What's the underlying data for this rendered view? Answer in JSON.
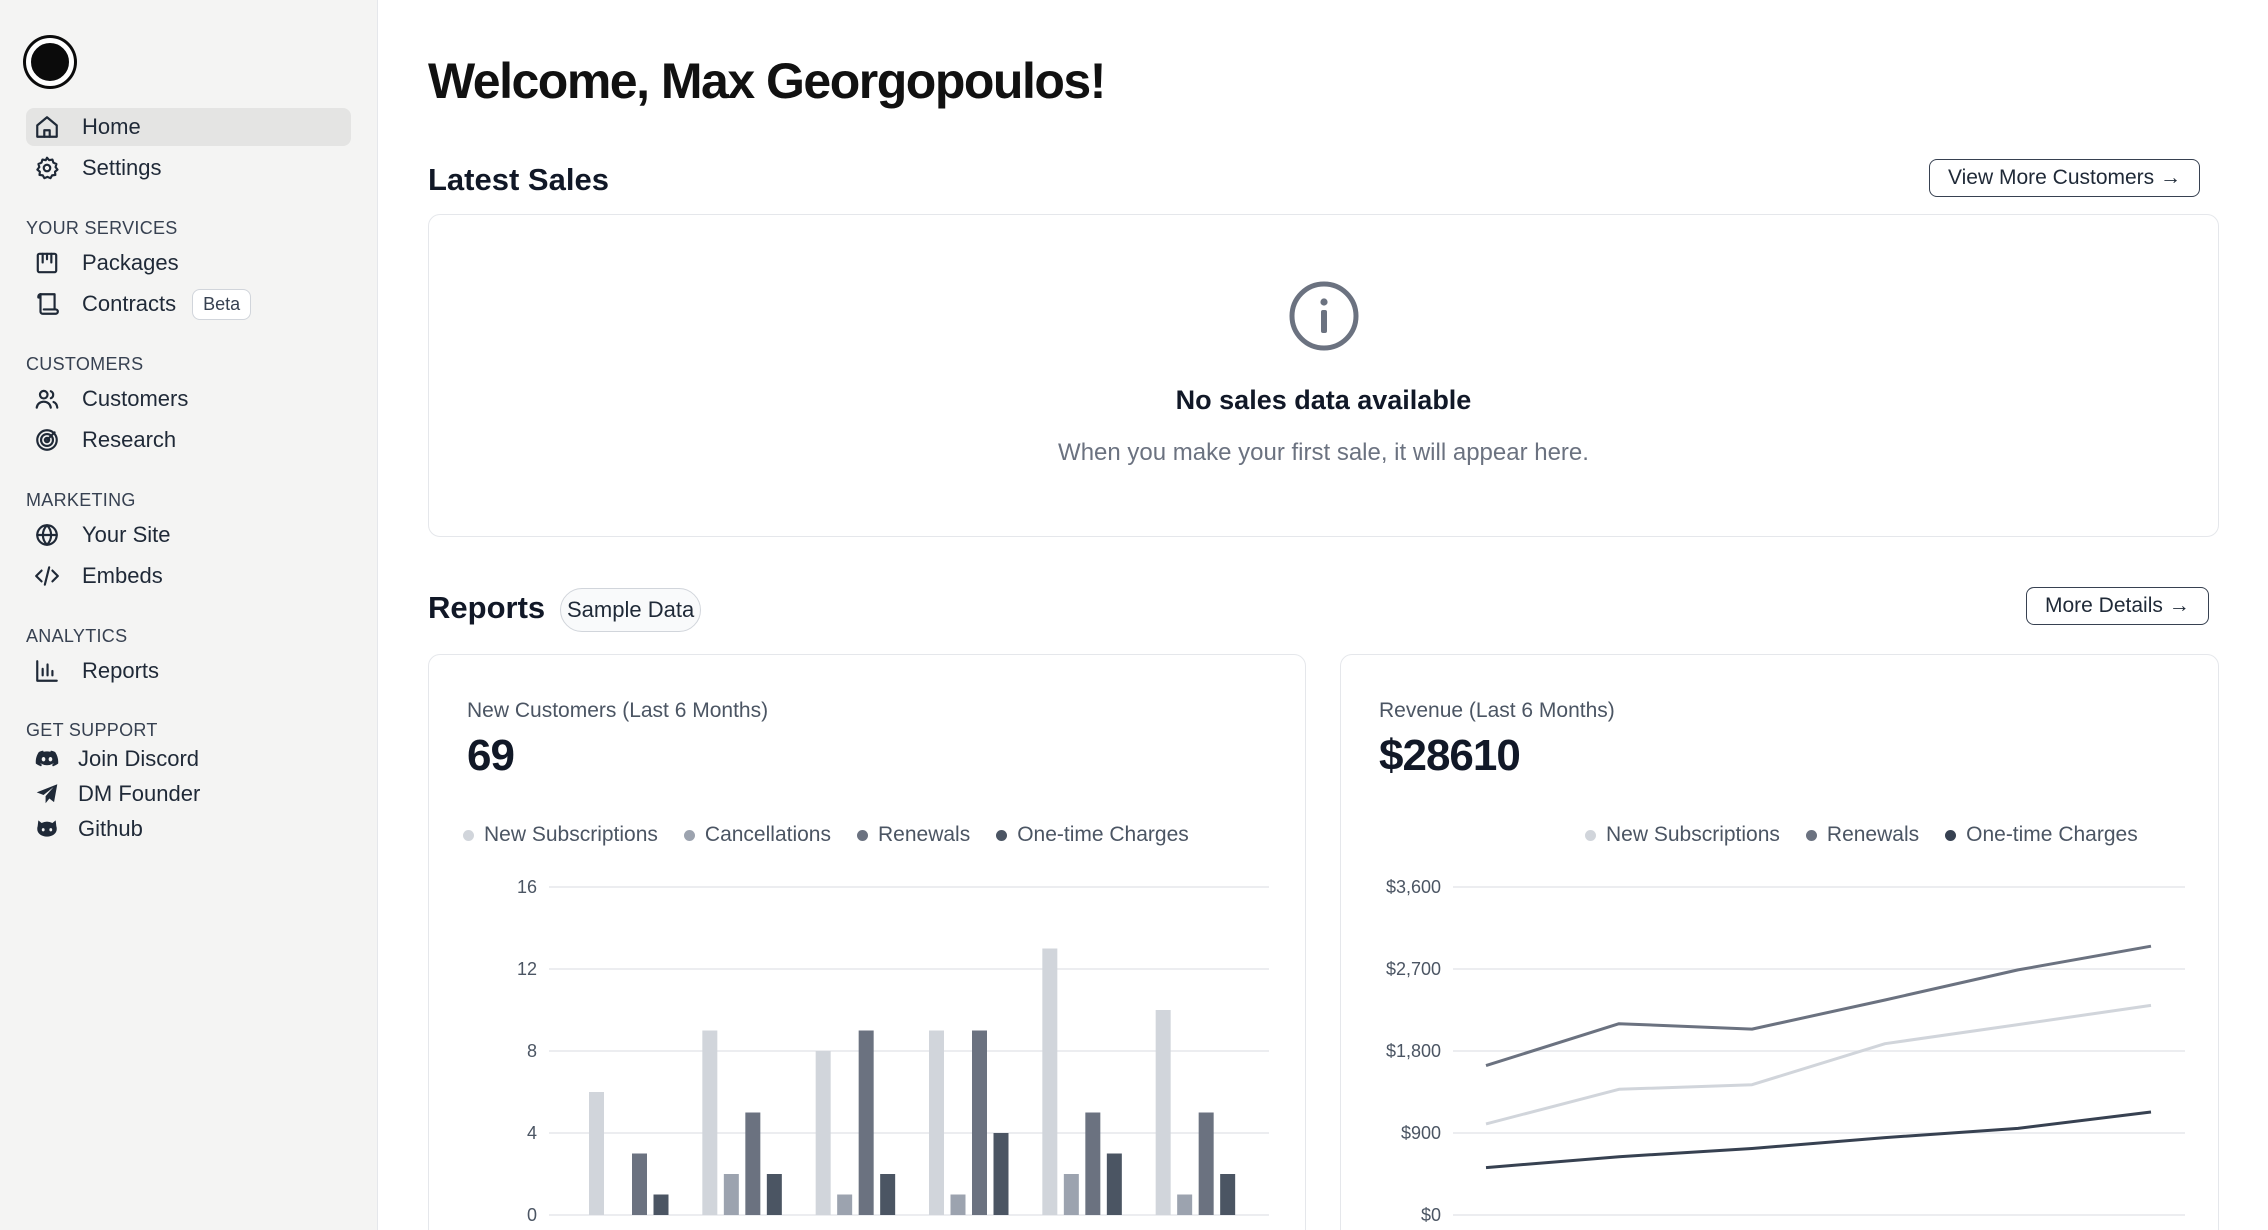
{
  "user": {
    "welcome": "Welcome, Max Georgopoulos!"
  },
  "sidebar": {
    "top_items": [
      {
        "label": "Home",
        "icon": "home-icon"
      },
      {
        "label": "Settings",
        "icon": "gear-icon"
      }
    ],
    "sections": {
      "services": {
        "title": "YOUR SERVICES",
        "items": [
          {
            "label": "Packages",
            "icon": "package-icon"
          },
          {
            "label": "Contracts",
            "icon": "scroll-icon",
            "badge": "Beta"
          }
        ]
      },
      "customers": {
        "title": "CUSTOMERS",
        "items": [
          {
            "label": "Customers",
            "icon": "users-icon"
          },
          {
            "label": "Research",
            "icon": "target-icon"
          }
        ]
      },
      "marketing": {
        "title": "MARKETING",
        "items": [
          {
            "label": "Your Site",
            "icon": "globe-icon"
          },
          {
            "label": "Embeds",
            "icon": "code-icon"
          }
        ]
      },
      "analytics": {
        "title": "ANALYTICS",
        "items": [
          {
            "label": "Reports",
            "icon": "bar-chart-icon"
          }
        ]
      },
      "support": {
        "title": "GET SUPPORT",
        "items": [
          {
            "label": "Join Discord",
            "icon": "discord-icon"
          },
          {
            "label": "DM Founder",
            "icon": "send-icon"
          },
          {
            "label": "Github",
            "icon": "github-icon"
          }
        ]
      }
    }
  },
  "latest_sales": {
    "title": "Latest Sales",
    "button": "View More Customers →",
    "empty_title": "No sales data available",
    "empty_subtitle": "When you make your first sale, it will appear here.",
    "empty_icon": "info-icon"
  },
  "reports": {
    "title": "Reports",
    "chip": "Sample Data",
    "button": "More Details →"
  },
  "colors": {
    "new_subscriptions": "#d1d5db",
    "cancellations": "#9ca3af",
    "renewals": "#6b7280",
    "one_time": "#4b5563"
  },
  "chart_data": [
    {
      "type": "bar",
      "label": "New Customers (Last 6 Months)",
      "value": "69",
      "legend": [
        "New Subscriptions",
        "Cancellations",
        "Renewals",
        "One-time Charges"
      ],
      "ylim": [
        0,
        16
      ],
      "yticks": [
        "0",
        "4",
        "8",
        "12",
        "16"
      ],
      "series": [
        {
          "name": "New Subscriptions",
          "color": "#d1d5db",
          "values": [
            6,
            9,
            8,
            9,
            13,
            10
          ]
        },
        {
          "name": "Cancellations",
          "color": "#9ca3af",
          "values": [
            0,
            2,
            1,
            1,
            2,
            1
          ]
        },
        {
          "name": "Renewals",
          "color": "#6b7280",
          "values": [
            3,
            5,
            9,
            9,
            5,
            5
          ]
        },
        {
          "name": "One-time Charges",
          "color": "#4b5563",
          "values": [
            1,
            2,
            2,
            4,
            3,
            2
          ]
        }
      ]
    },
    {
      "type": "line",
      "label": "Revenue (Last 6 Months)",
      "value": "$28610",
      "legend": [
        "New Subscriptions",
        "Renewals",
        "One-time Charges"
      ],
      "ylim": [
        0,
        3600
      ],
      "yticks": [
        "$0",
        "$900",
        "$1,800",
        "$2,700",
        "$3,600"
      ],
      "series": [
        {
          "name": "New Subscriptions",
          "color": "#d1d5db",
          "values": [
            1000,
            1380,
            1430,
            1880,
            2090,
            2300
          ]
        },
        {
          "name": "Renewals",
          "color": "#6b7280",
          "values": [
            1640,
            2100,
            2040,
            2360,
            2690,
            2950
          ]
        },
        {
          "name": "One-time Charges",
          "color": "#374151",
          "values": [
            520,
            640,
            730,
            850,
            950,
            1130
          ]
        }
      ]
    }
  ]
}
